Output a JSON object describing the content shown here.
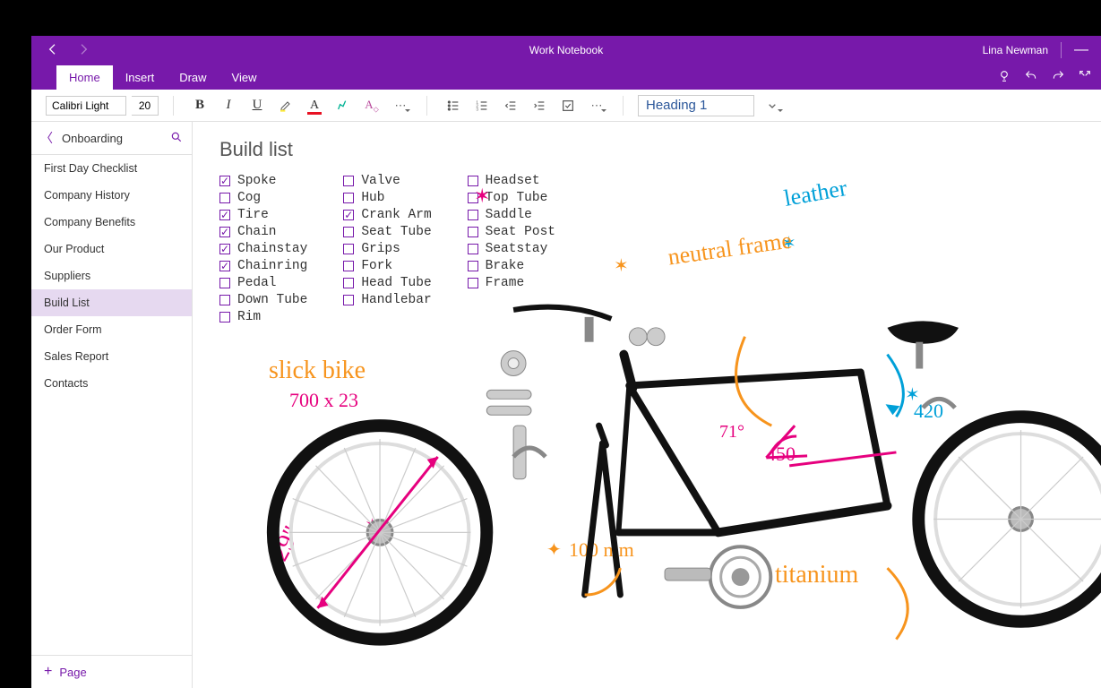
{
  "window": {
    "title": "Work Notebook",
    "user": "Lina Newman"
  },
  "tabs": {
    "items": [
      "Home",
      "Insert",
      "Draw",
      "View"
    ],
    "active": "Home"
  },
  "ribbon": {
    "font_name": "Calibri Light",
    "font_size": "20",
    "style_name": "Heading 1"
  },
  "sidebar": {
    "section": "Onboarding",
    "pages": [
      "First Day Checklist",
      "Company History",
      "Company Benefits",
      "Our Product",
      "Suppliers",
      "Build List",
      "Order Form",
      "Sales Report",
      "Contacts"
    ],
    "selected_page": "Build List",
    "add_page_label": "Page"
  },
  "note": {
    "title": "Build list",
    "columns": [
      [
        {
          "label": "Spoke",
          "checked": true
        },
        {
          "label": "Cog",
          "checked": false
        },
        {
          "label": "Tire",
          "checked": true
        },
        {
          "label": "Chain",
          "checked": true
        },
        {
          "label": "Chainstay",
          "checked": true
        },
        {
          "label": "Chainring",
          "checked": true
        },
        {
          "label": "Pedal",
          "checked": false
        },
        {
          "label": "Down Tube",
          "checked": false
        },
        {
          "label": "Rim",
          "checked": false
        }
      ],
      [
        {
          "label": "Valve",
          "checked": false
        },
        {
          "label": "Hub",
          "checked": false
        },
        {
          "label": "Crank Arm",
          "checked": true
        },
        {
          "label": "Seat Tube",
          "checked": false
        },
        {
          "label": "Grips",
          "checked": false
        },
        {
          "label": "Fork",
          "checked": false
        },
        {
          "label": "Head Tube",
          "checked": false
        },
        {
          "label": "Handlebar",
          "checked": false
        }
      ],
      [
        {
          "label": "Headset",
          "checked": false
        },
        {
          "label": "Top Tube",
          "checked": false
        },
        {
          "label": "Saddle",
          "checked": false
        },
        {
          "label": "Seat Post",
          "checked": false
        },
        {
          "label": "Seatstay",
          "checked": false
        },
        {
          "label": "Brake",
          "checked": false
        },
        {
          "label": "Frame",
          "checked": false
        }
      ]
    ]
  },
  "ink": {
    "slick_bike": "slick bike",
    "wheel_size": "700 x 23",
    "wheel_29": "29\"",
    "hundred_mm": "100 mm",
    "angle": "71°",
    "four_fifty": "450",
    "four_twenty": "420",
    "leather": "leather",
    "neutral_frame": "neutral frame",
    "titanium": "titanium"
  }
}
